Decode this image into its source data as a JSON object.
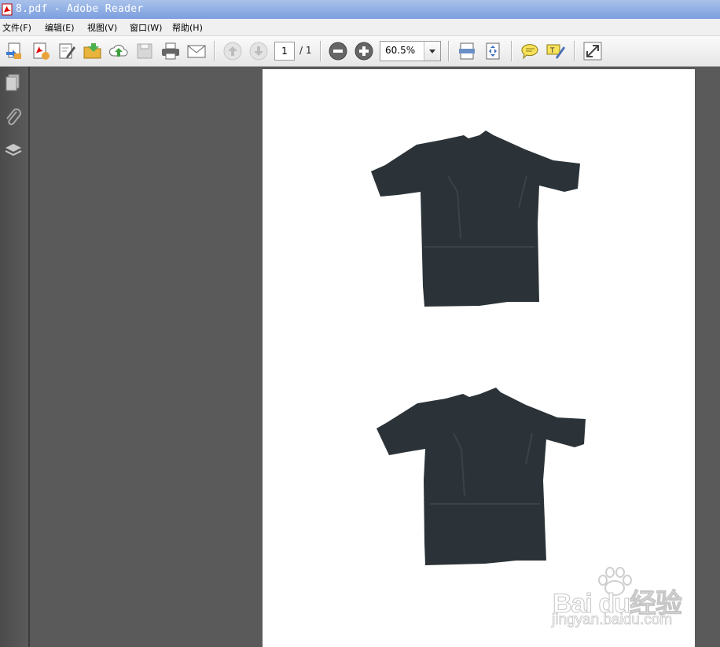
{
  "window": {
    "title": "8.pdf - Adobe Reader"
  },
  "menu": [
    "文件(F)",
    "编辑(E)",
    "视图(V)",
    "窗口(W)",
    "帮助(H)"
  ],
  "toolbar": {
    "icons": [
      "create-pdf-icon",
      "convert-icon",
      "edit-icon",
      "open-icon",
      "upload-icon",
      "save-icon",
      "print-icon",
      "email-icon",
      "previous-page-icon",
      "next-page-icon",
      "zoom-out-icon",
      "zoom-in-icon",
      "fit-width-icon",
      "fit-page-icon",
      "comment-icon",
      "highlight-icon",
      "fullscreen-icon"
    ],
    "page_current": "1",
    "page_total": "/ 1",
    "zoom": "60.5%"
  },
  "sidebar": {
    "icons": [
      "pages-icon",
      "attachments-icon",
      "layers-icon"
    ]
  },
  "watermark": {
    "brand": "Bai du经验",
    "url": "jingyan.baidu.com"
  },
  "colors": {
    "titlebar": "#7b9ee0",
    "workspace": "#5a5a5a",
    "shirt": "#2b3338"
  }
}
